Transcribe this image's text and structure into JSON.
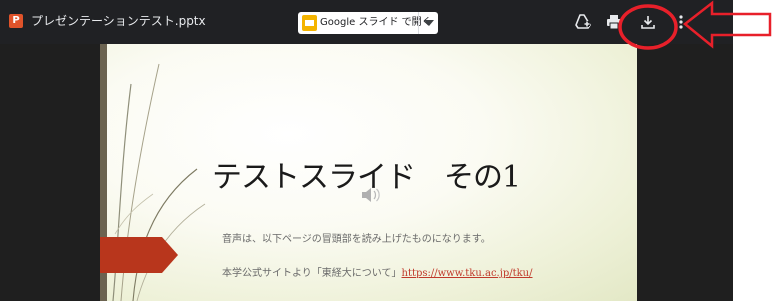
{
  "toolbar": {
    "app_letter": "P",
    "file_name": "プレゼンテーションテスト.pptx",
    "open_with_label": "Google スライド で開く"
  },
  "slide": {
    "title": "テストスライド　その1",
    "body_line1": "音声は、以下ページの冒頭部を読み上げたものになります。",
    "body_line2_prefix": "本学公式サイトより「東経大について」",
    "body_link": "https://www.tku.ac.jp/tku/"
  },
  "icons": {
    "add_to_drive": "add-to-drive-icon",
    "print": "print-icon",
    "download": "download-icon",
    "more": "more-vert-icon",
    "speaker": "speaker-icon"
  },
  "colors": {
    "toolbar_bg": "#202124",
    "app_badge": "#e0532a",
    "slides_yellow": "#f4b400",
    "annotation_red": "#e8202a",
    "accent_pentagon": "#b8361c"
  }
}
